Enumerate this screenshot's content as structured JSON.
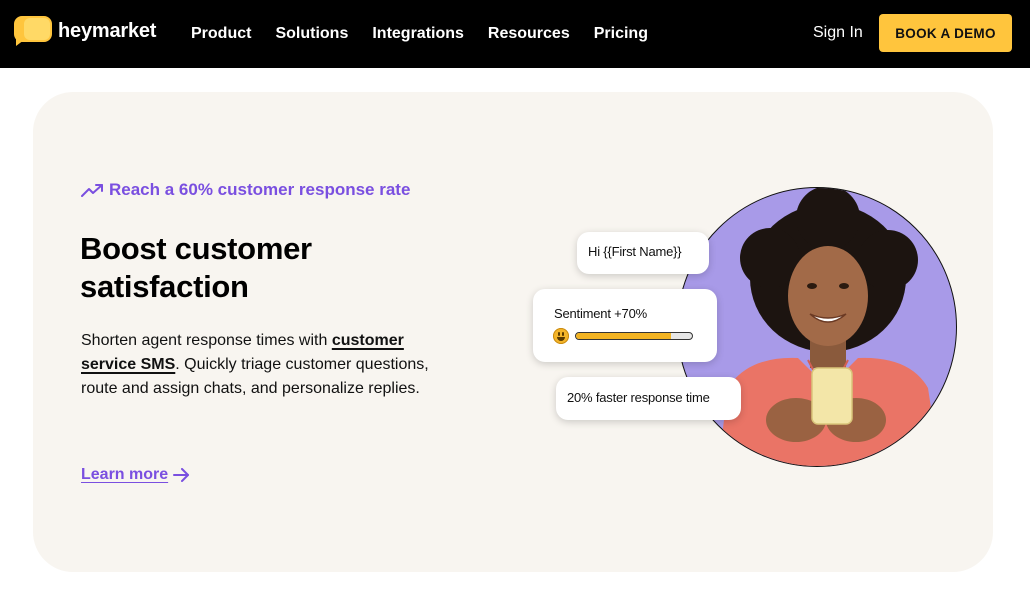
{
  "nav": {
    "brand": "heymarket",
    "links": [
      "Product",
      "Solutions",
      "Integrations",
      "Resources",
      "Pricing"
    ],
    "sign_in": "Sign In",
    "cta": "BOOK A DEMO"
  },
  "feature": {
    "eyebrow": "Reach a 60% customer response rate",
    "headline": "Boost customer satisfaction",
    "body_before": "Shorten agent response times with ",
    "body_link": "customer service SMS",
    "body_after": ". Quickly triage customer questions, route and assign chats, and personalize replies.",
    "learn_more": "Learn more"
  },
  "illustration": {
    "greeting_bubble": "Hi {{First Name}}",
    "sentiment_label": "Sentiment +70%",
    "sentiment_progress": 0.82,
    "speed_bubble": "20% faster response time"
  },
  "colors": {
    "accent": "#7a4fe0",
    "cta_yellow": "#ffc53d",
    "card_bg": "#f8f5f0",
    "circle_bg": "#a89ae8"
  },
  "icons": {
    "eyebrow": "trending-up-icon",
    "learn_more": "arrow-right-icon",
    "sentiment": "grinning-face-icon"
  }
}
